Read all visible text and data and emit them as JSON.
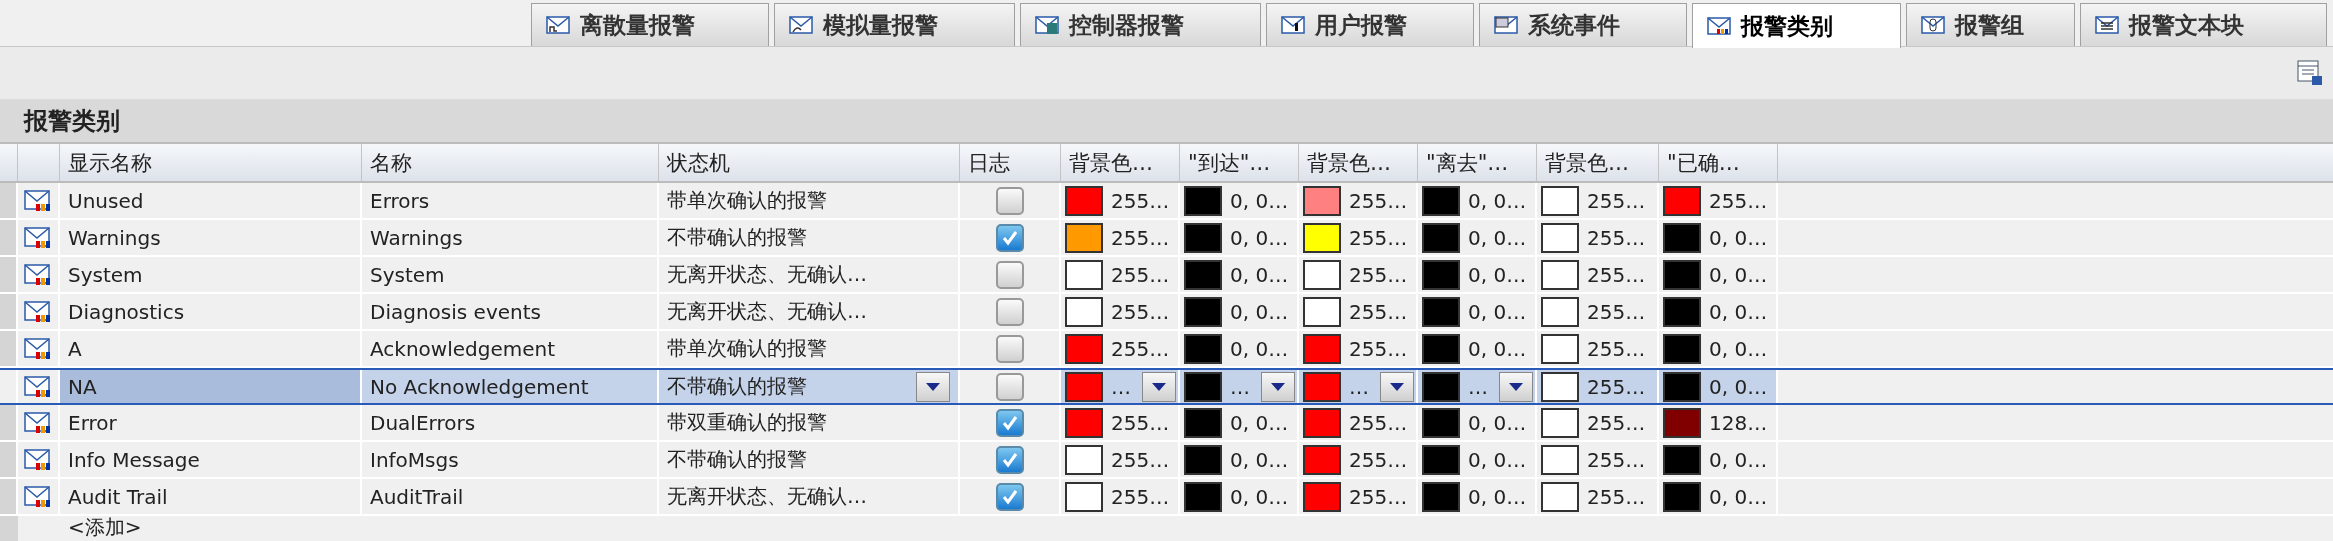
{
  "tabs": [
    {
      "label": "离散量报警",
      "selected": false,
      "kind": "discrete"
    },
    {
      "label": "模拟量报警",
      "selected": false,
      "kind": "analog"
    },
    {
      "label": "控制器报警",
      "selected": false,
      "kind": "controller"
    },
    {
      "label": "用户报警",
      "selected": false,
      "kind": "user"
    },
    {
      "label": "系统事件",
      "selected": false,
      "kind": "system"
    },
    {
      "label": "报警类别",
      "selected": true,
      "kind": "classes"
    },
    {
      "label": "报警组",
      "selected": false,
      "kind": "group"
    },
    {
      "label": "报警文本块",
      "selected": false,
      "kind": "text"
    }
  ],
  "section_title": "报警类别",
  "table": {
    "columns": [
      "显示名称",
      "名称",
      "状态机",
      "日志",
      "背景色…",
      "\"到达\"…",
      "背景色…",
      "\"离去\"…",
      "背景色…",
      "\"已确…"
    ],
    "rows": [
      {
        "display_name": "Unused",
        "name": "Errors",
        "state_machine": "带单次确认的报警",
        "log": false,
        "selected": false,
        "colors": [
          {
            "color": "#ff0000",
            "text": "255…",
            "dropdown": false
          },
          {
            "color": "#000000",
            "text": "0, 0…",
            "dropdown": false
          },
          {
            "color": "#ff8080",
            "text": "255…",
            "dropdown": false
          },
          {
            "color": "#000000",
            "text": "0, 0…",
            "dropdown": false
          },
          {
            "color": "#ffffff",
            "text": "255…",
            "dropdown": false
          },
          {
            "color": "#ff0000",
            "text": "255…",
            "dropdown": false
          }
        ]
      },
      {
        "display_name": "Warnings",
        "name": "Warnings",
        "state_machine": "不带确认的报警",
        "log": true,
        "selected": false,
        "colors": [
          {
            "color": "#ff9900",
            "text": "255…",
            "dropdown": false
          },
          {
            "color": "#000000",
            "text": "0, 0…",
            "dropdown": false
          },
          {
            "color": "#ffff00",
            "text": "255…",
            "dropdown": false
          },
          {
            "color": "#000000",
            "text": "0, 0…",
            "dropdown": false
          },
          {
            "color": "#ffffff",
            "text": "255…",
            "dropdown": false
          },
          {
            "color": "#000000",
            "text": "0, 0…",
            "dropdown": false
          }
        ]
      },
      {
        "display_name": "System",
        "name": "System",
        "state_machine": "无离开状态、无确认…",
        "log": false,
        "selected": false,
        "colors": [
          {
            "color": "#ffffff",
            "text": "255…",
            "dropdown": false
          },
          {
            "color": "#000000",
            "text": "0, 0…",
            "dropdown": false
          },
          {
            "color": "#ffffff",
            "text": "255…",
            "dropdown": false
          },
          {
            "color": "#000000",
            "text": "0, 0…",
            "dropdown": false
          },
          {
            "color": "#ffffff",
            "text": "255…",
            "dropdown": false
          },
          {
            "color": "#000000",
            "text": "0, 0…",
            "dropdown": false
          }
        ]
      },
      {
        "display_name": "Diagnostics",
        "name": "Diagnosis events",
        "state_machine": "无离开状态、无确认…",
        "log": false,
        "selected": false,
        "colors": [
          {
            "color": "#ffffff",
            "text": "255…",
            "dropdown": false
          },
          {
            "color": "#000000",
            "text": "0, 0…",
            "dropdown": false
          },
          {
            "color": "#ffffff",
            "text": "255…",
            "dropdown": false
          },
          {
            "color": "#000000",
            "text": "0, 0…",
            "dropdown": false
          },
          {
            "color": "#ffffff",
            "text": "255…",
            "dropdown": false
          },
          {
            "color": "#000000",
            "text": "0, 0…",
            "dropdown": false
          }
        ]
      },
      {
        "display_name": "A",
        "name": "Acknowledgement",
        "state_machine": "带单次确认的报警",
        "log": false,
        "selected": false,
        "colors": [
          {
            "color": "#ff0000",
            "text": "255…",
            "dropdown": false
          },
          {
            "color": "#000000",
            "text": "0, 0…",
            "dropdown": false
          },
          {
            "color": "#ff0000",
            "text": "255…",
            "dropdown": false
          },
          {
            "color": "#000000",
            "text": "0, 0…",
            "dropdown": false
          },
          {
            "color": "#ffffff",
            "text": "255…",
            "dropdown": false
          },
          {
            "color": "#000000",
            "text": "0, 0…",
            "dropdown": false
          }
        ]
      },
      {
        "display_name": "NA",
        "name": "No Acknowledgement",
        "state_machine": "不带确认的报警",
        "log": false,
        "selected": true,
        "colors": [
          {
            "color": "#ff0000",
            "text": "…",
            "dropdown": true
          },
          {
            "color": "#000000",
            "text": "…",
            "dropdown": true
          },
          {
            "color": "#ff0000",
            "text": "…",
            "dropdown": true
          },
          {
            "color": "#000000",
            "text": "…",
            "dropdown": true
          },
          {
            "color": "#ffffff",
            "text": "255…",
            "dropdown": false
          },
          {
            "color": "#000000",
            "text": "0, 0…",
            "dropdown": false
          }
        ]
      },
      {
        "display_name": "Error",
        "name": "DualErrors",
        "state_machine": "带双重确认的报警",
        "log": true,
        "selected": false,
        "colors": [
          {
            "color": "#ff0000",
            "text": "255…",
            "dropdown": false
          },
          {
            "color": "#000000",
            "text": "0, 0…",
            "dropdown": false
          },
          {
            "color": "#ff0000",
            "text": "255…",
            "dropdown": false
          },
          {
            "color": "#000000",
            "text": "0, 0…",
            "dropdown": false
          },
          {
            "color": "#ffffff",
            "text": "255…",
            "dropdown": false
          },
          {
            "color": "#800000",
            "text": "128…",
            "dropdown": false
          }
        ]
      },
      {
        "display_name": "Info Message",
        "name": "InfoMsgs",
        "state_machine": "不带确认的报警",
        "log": true,
        "selected": false,
        "colors": [
          {
            "color": "#ffffff",
            "text": "255…",
            "dropdown": false
          },
          {
            "color": "#000000",
            "text": "0, 0…",
            "dropdown": false
          },
          {
            "color": "#ff0000",
            "text": "255…",
            "dropdown": false
          },
          {
            "color": "#000000",
            "text": "0, 0…",
            "dropdown": false
          },
          {
            "color": "#ffffff",
            "text": "255…",
            "dropdown": false
          },
          {
            "color": "#000000",
            "text": "0, 0…",
            "dropdown": false
          }
        ]
      },
      {
        "display_name": "Audit Trail",
        "name": "AuditTrail",
        "state_machine": "无离开状态、无确认…",
        "log": true,
        "selected": false,
        "colors": [
          {
            "color": "#ffffff",
            "text": "255…",
            "dropdown": false
          },
          {
            "color": "#000000",
            "text": "0, 0…",
            "dropdown": false
          },
          {
            "color": "#ff0000",
            "text": "255…",
            "dropdown": false
          },
          {
            "color": "#000000",
            "text": "0, 0…",
            "dropdown": false
          },
          {
            "color": "#ffffff",
            "text": "255…",
            "dropdown": false
          },
          {
            "color": "#000000",
            "text": "0, 0…",
            "dropdown": false
          }
        ]
      }
    ],
    "add_row": "<添加>"
  }
}
